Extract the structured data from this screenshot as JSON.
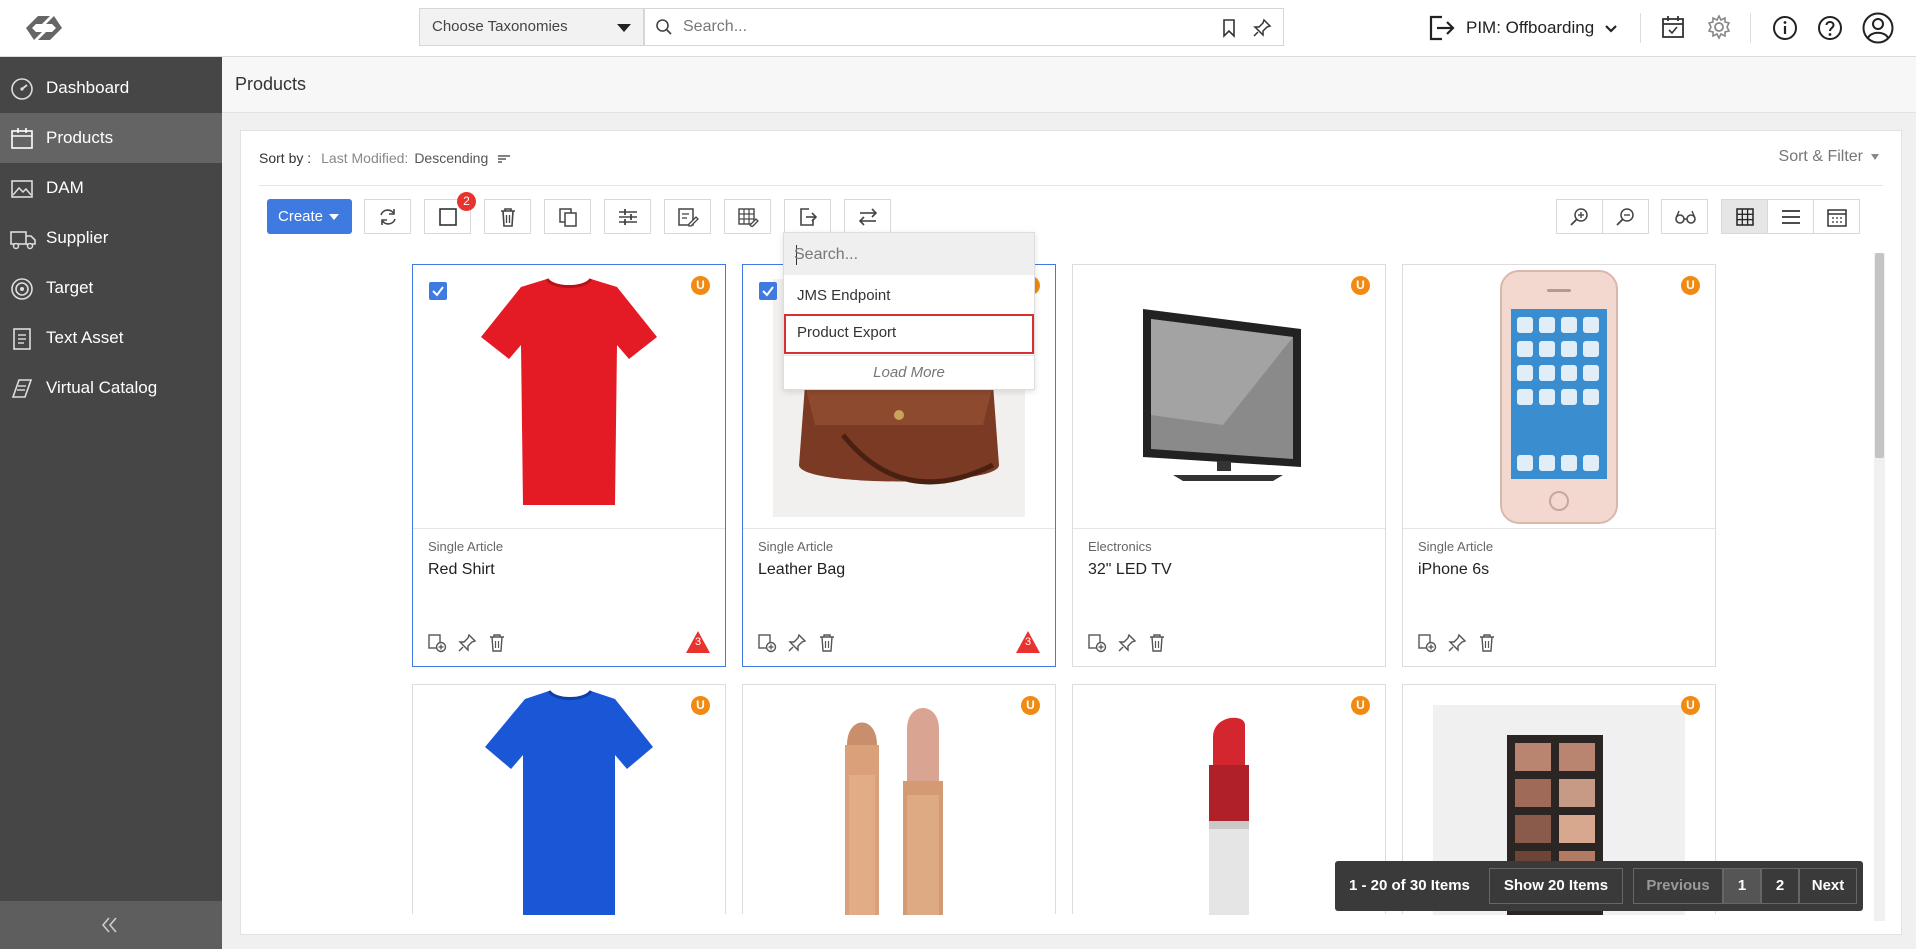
{
  "header": {
    "taxonomy_label": "Choose Taxonomies",
    "search_placeholder": "Search...",
    "workflow_label": "PIM: Offboarding"
  },
  "sidebar": {
    "items": [
      {
        "label": "Dashboard",
        "icon": "dashboard-icon"
      },
      {
        "label": "Products",
        "icon": "products-icon",
        "active": true
      },
      {
        "label": "DAM",
        "icon": "image-icon"
      },
      {
        "label": "Supplier",
        "icon": "truck-icon"
      },
      {
        "label": "Target",
        "icon": "target-icon"
      },
      {
        "label": "Text Asset",
        "icon": "document-icon"
      },
      {
        "label": "Virtual Catalog",
        "icon": "catalog-icon"
      }
    ]
  },
  "page": {
    "title": "Products"
  },
  "sort": {
    "label": "Sort by :",
    "field": "Last Modified:",
    "order": "Descending",
    "filter_label": "Sort & Filter"
  },
  "toolbar": {
    "create_label": "Create",
    "selected_count": "2"
  },
  "export_dropdown": {
    "search_placeholder": "Search...",
    "items": [
      "JMS Endpoint",
      "Product Export"
    ],
    "highlighted": "Product Export",
    "load_more": "Load More"
  },
  "products": [
    {
      "type": "Single Article",
      "name": "Red Shirt",
      "status": "U",
      "warnings": "3",
      "selected": true
    },
    {
      "type": "Single Article",
      "name": "Leather Bag",
      "status": "U",
      "warnings": "3",
      "selected": true
    },
    {
      "type": "Electronics",
      "name": "32\" LED TV",
      "status": "U"
    },
    {
      "type": "Single Article",
      "name": "iPhone 6s",
      "status": "U"
    },
    {
      "status": "U"
    },
    {
      "status": "U"
    },
    {
      "status": "U"
    },
    {
      "status": "U"
    }
  ],
  "pagination": {
    "range": "1 - 20 of 30 Items",
    "page_size": "Show 20 Items",
    "previous": "Previous",
    "pages": [
      "1",
      "2"
    ],
    "next": "Next"
  },
  "colors": {
    "accent": "#3e7ae0",
    "sidebar": "#464646",
    "status_badge": "#f08a12",
    "alert": "#e8322e"
  }
}
